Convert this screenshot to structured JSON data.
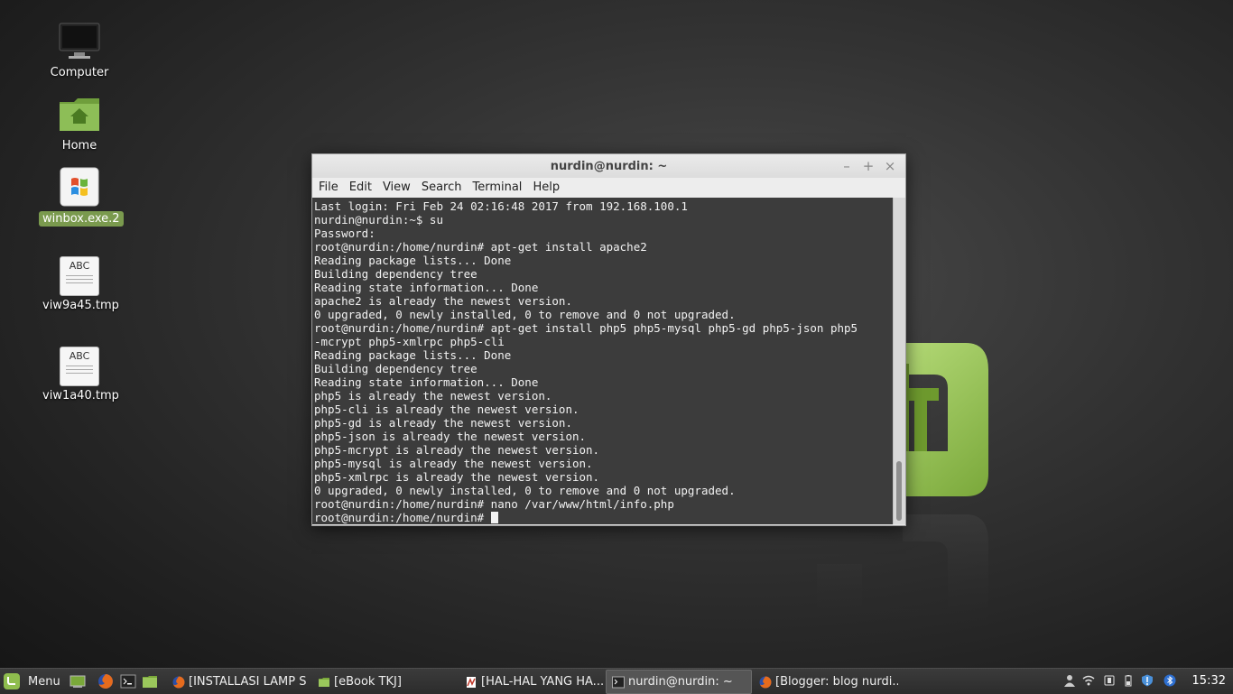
{
  "desktop": {
    "icons": [
      {
        "label": "Computer"
      },
      {
        "label": "Home"
      },
      {
        "label": "winbox.exe.2"
      },
      {
        "label": "viw9a45.tmp",
        "thumb_text": "ABC"
      },
      {
        "label": "viw1a40.tmp",
        "thumb_text": "ABC"
      }
    ]
  },
  "window": {
    "title": "nurdin@nurdin: ~",
    "controls": {
      "minimize": "–",
      "maximize": "+",
      "close": "×"
    },
    "menu": [
      "File",
      "Edit",
      "View",
      "Search",
      "Terminal",
      "Help"
    ],
    "terminal_lines": [
      "Last login: Fri Feb 24 02:16:48 2017 from 192.168.100.1",
      "nurdin@nurdin:~$ su",
      "Password: ",
      "root@nurdin:/home/nurdin# apt-get install apache2",
      "Reading package lists... Done",
      "Building dependency tree",
      "Reading state information... Done",
      "apache2 is already the newest version.",
      "0 upgraded, 0 newly installed, 0 to remove and 0 not upgraded.",
      "root@nurdin:/home/nurdin# apt-get install php5 php5-mysql php5-gd php5-json php5",
      "-mcrypt php5-xmlrpc php5-cli",
      "Reading package lists... Done",
      "Building dependency tree",
      "Reading state information... Done",
      "php5 is already the newest version.",
      "php5-cli is already the newest version.",
      "php5-gd is already the newest version.",
      "php5-json is already the newest version.",
      "php5-mcrypt is already the newest version.",
      "php5-mysql is already the newest version.",
      "php5-xmlrpc is already the newest version.",
      "0 upgraded, 0 newly installed, 0 to remove and 0 not upgraded.",
      "root@nurdin:/home/nurdin# nano /var/www/html/info.php"
    ],
    "prompt": "root@nurdin:/home/nurdin# "
  },
  "taskbar": {
    "menu_label": "Menu",
    "tasks": [
      {
        "label": "[INSTALLASI LAMP S...",
        "icon": "firefox-icon"
      },
      {
        "label": "[eBook TKJ]",
        "icon": "folder-icon"
      },
      {
        "label": "[HAL-HAL YANG HA...",
        "icon": "document-viewer-icon"
      },
      {
        "label": "nurdin@nurdin: ~",
        "icon": "terminal-icon"
      },
      {
        "label": "[Blogger: blog nurdi...",
        "icon": "firefox-icon"
      }
    ],
    "clock": "15:32"
  },
  "colors": {
    "mint_green": "#8fbd4e",
    "terminal_bg": "#3c3c3c",
    "selected_label": "#7a9a4e"
  }
}
